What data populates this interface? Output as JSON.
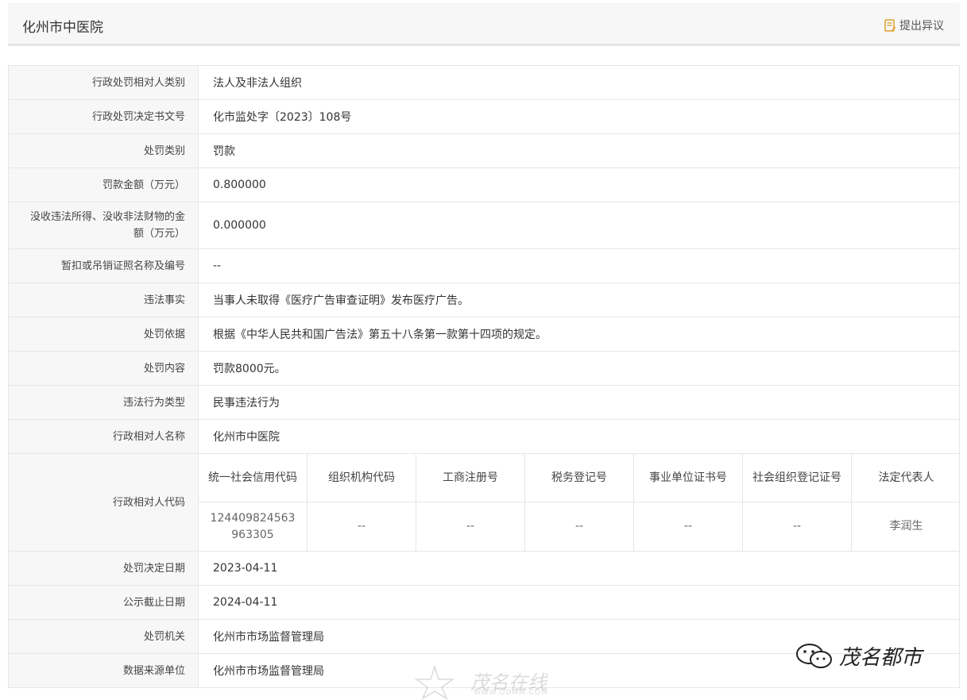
{
  "header": {
    "title": "化州市中医院",
    "objection_label": "提出异议"
  },
  "rows_top": [
    {
      "label": "行政处罚相对人类别",
      "value": "法人及非法人组织"
    },
    {
      "label": "行政处罚决定书文号",
      "value": "化市监处字〔2023〕108号"
    },
    {
      "label": "处罚类别",
      "value": "罚款"
    },
    {
      "label": "罚款金额（万元）",
      "value": "0.800000"
    },
    {
      "label": "没收违法所得、没收非法财物的金额（万元）",
      "value": "0.000000"
    },
    {
      "label": "暂扣或吊销证照名称及编号",
      "value": "--"
    },
    {
      "label": "违法事实",
      "value": "当事人未取得《医疗广告审查证明》发布医疗广告。"
    },
    {
      "label": "处罚依据",
      "value": "根据《中华人民共和国广告法》第五十八条第一款第十四项的规定。"
    },
    {
      "label": "处罚内容",
      "value": "罚款8000元。"
    },
    {
      "label": "违法行为类型",
      "value": "民事违法行为"
    },
    {
      "label": "行政相对人名称",
      "value": "化州市中医院"
    }
  ],
  "code_section": {
    "label": "行政相对人代码",
    "headers": [
      "统一社会信用代码",
      "组织机构代码",
      "工商注册号",
      "税务登记号",
      "事业单位证书号",
      "社会组织登记证号",
      "法定代表人"
    ],
    "values": [
      "124409824563963305",
      "--",
      "--",
      "--",
      "--",
      "--",
      "李润生"
    ]
  },
  "rows_bottom": [
    {
      "label": "处罚决定日期",
      "value": "2023-04-11"
    },
    {
      "label": "公示截止日期",
      "value": "2024-04-11"
    },
    {
      "label": "处罚机关",
      "value": "化州市市场监督管理局"
    },
    {
      "label": "数据来源单位",
      "value": "化州市市场监督管理局"
    }
  ],
  "watermarks": {
    "right_text": "茂名都市",
    "center_text": "茂名在线",
    "center_url": "WWW.GDMM.COM"
  }
}
